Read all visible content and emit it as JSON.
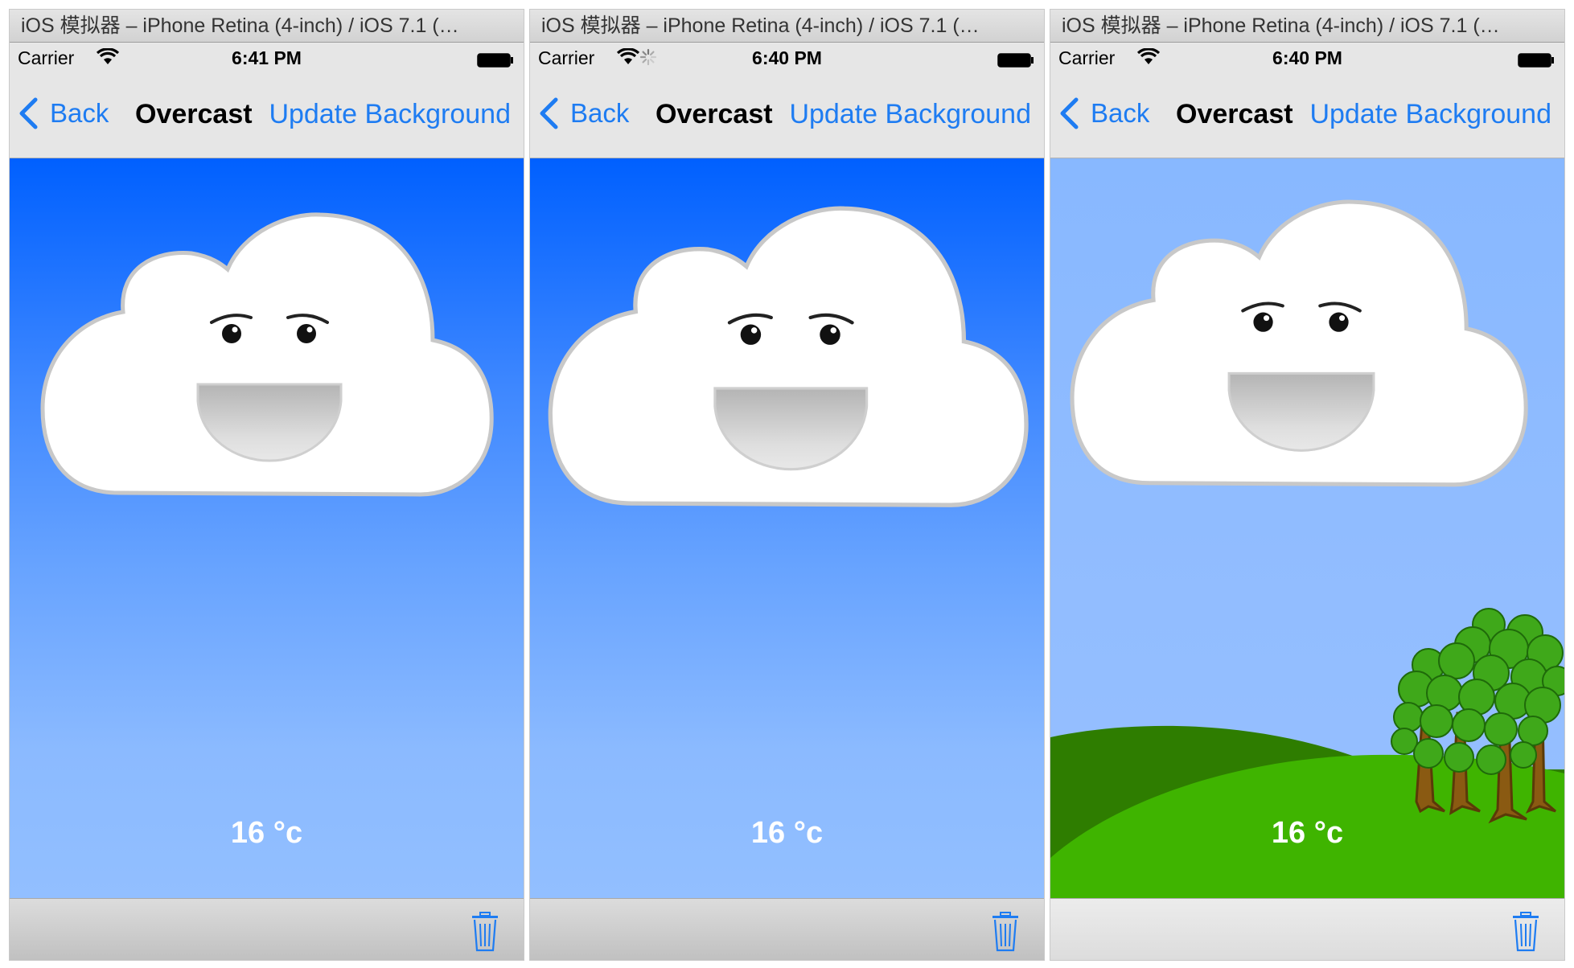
{
  "screens": [
    {
      "window_title": "iOS 模拟器 – iPhone Retina (4-inch) / iOS 7.1 (…",
      "status": {
        "carrier": "Carrier",
        "time": "6:41 PM",
        "network_activity": false
      },
      "nav": {
        "back_label": "Back",
        "title": "Overcast",
        "action_label": "Update Background"
      },
      "temperature": "16 °c",
      "background": "sky-gradient"
    },
    {
      "window_title": "iOS 模拟器 – iPhone Retina (4-inch) / iOS 7.1 (…",
      "status": {
        "carrier": "Carrier",
        "time": "6:40 PM",
        "network_activity": true
      },
      "nav": {
        "back_label": "Back",
        "title": "Overcast",
        "action_label": "Update Background"
      },
      "temperature": "16 °c",
      "background": "sky-gradient"
    },
    {
      "window_title": "iOS 模拟器 – iPhone Retina (4-inch) / iOS 7.1 (…",
      "status": {
        "carrier": "Carrier",
        "time": "6:40 PM",
        "network_activity": false
      },
      "nav": {
        "back_label": "Back",
        "title": "Overcast",
        "action_label": "Update Background"
      },
      "temperature": "16 °c",
      "background": "hills-and-trees"
    }
  ],
  "colors": {
    "ios_blue": "#1e7cf2",
    "sky_top": "#0060ff",
    "sky_bottom": "#92bfff",
    "hill_dark": "#2e7d00",
    "hill_light": "#3fb400",
    "tree_trunk": "#8a5a12",
    "tree_leaf": "#3fa81a"
  },
  "icons": [
    "wifi-icon",
    "activity-indicator-icon",
    "battery-icon",
    "back-chevron-icon",
    "cloud-face-icon",
    "trash-icon"
  ]
}
